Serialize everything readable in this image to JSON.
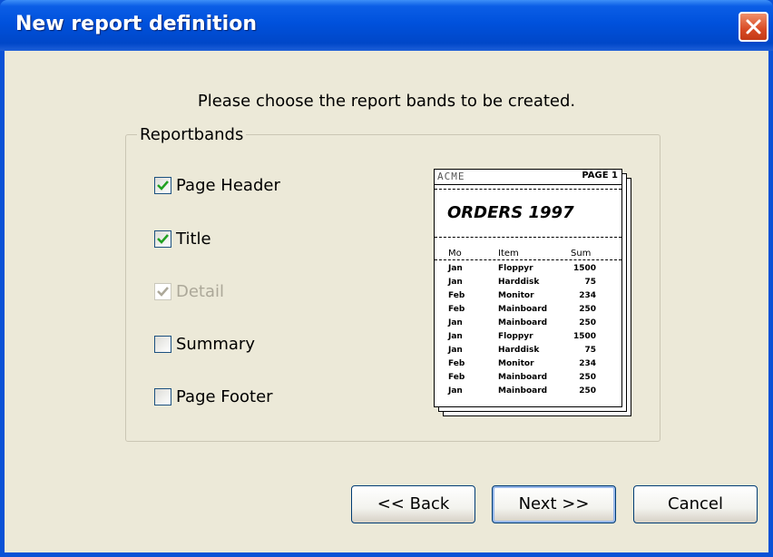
{
  "window": {
    "title": "New report definition"
  },
  "prompt": "Please choose the report bands to be created.",
  "group": {
    "legend": "Reportbands",
    "options": [
      {
        "label": "Page Header",
        "checked": true,
        "disabled": false
      },
      {
        "label": "Title",
        "checked": true,
        "disabled": false
      },
      {
        "label": "Detail",
        "checked": true,
        "disabled": true
      },
      {
        "label": "Summary",
        "checked": false,
        "disabled": false
      },
      {
        "label": "Page Footer",
        "checked": false,
        "disabled": false
      }
    ]
  },
  "preview": {
    "company": "ACME",
    "page_label": "PAGE 1",
    "report_title": "ORDERS 1997",
    "columns": [
      "Mo",
      "Item",
      "Sum"
    ],
    "rows": [
      [
        "Jan",
        "Floppyr",
        "1500"
      ],
      [
        "Jan",
        "Harddisk",
        "75"
      ],
      [
        "Feb",
        "Monitor",
        "234"
      ],
      [
        "Feb",
        "Mainboard",
        "250"
      ],
      [
        "Jan",
        "Mainboard",
        "250"
      ],
      [
        "Jan",
        "Floppyr",
        "1500"
      ],
      [
        "Jan",
        "Harddisk",
        "75"
      ],
      [
        "Feb",
        "Monitor",
        "234"
      ],
      [
        "Feb",
        "Mainboard",
        "250"
      ],
      [
        "Jan",
        "Mainboard",
        "250"
      ]
    ]
  },
  "buttons": {
    "back": "<< Back",
    "next": "Next >>",
    "cancel": "Cancel"
  },
  "icons": {
    "close": "close-icon",
    "check": "checkmark-icon"
  },
  "colors": {
    "titlebar": "#0051dc",
    "close": "#d84a25",
    "check": "#21a121",
    "check_disabled": "#aca899"
  }
}
